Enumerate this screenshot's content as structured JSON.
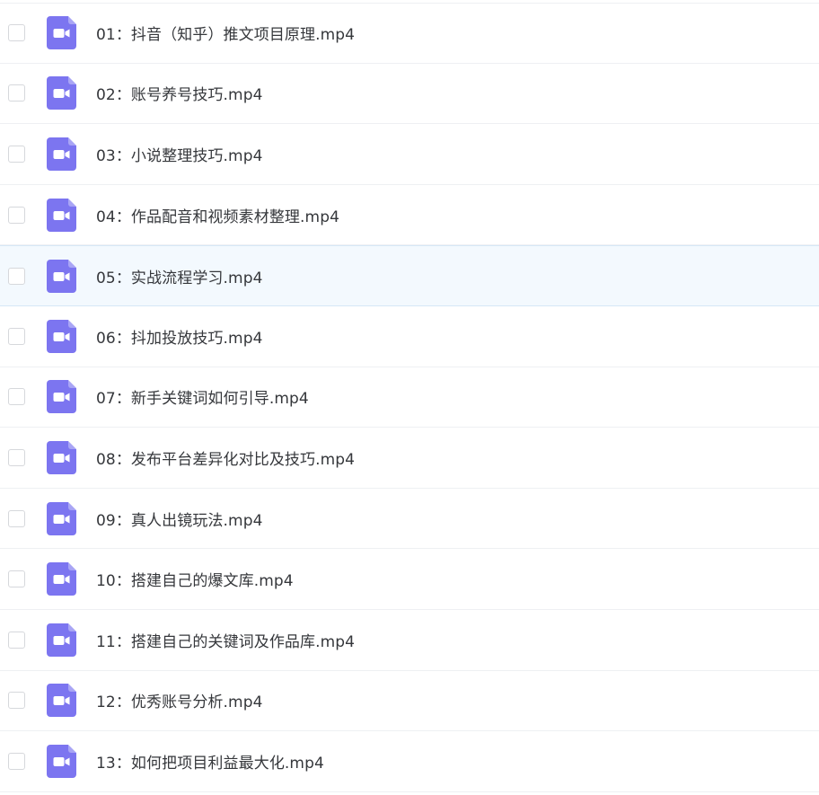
{
  "file_list": {
    "icon": "video-file-icon",
    "icon_color": "#7c75f0",
    "hovered_index": 4,
    "hover_color": "#f3f9fe",
    "items": [
      {
        "name": "01：抖音（知乎）推文项目原理.mp4"
      },
      {
        "name": "02：账号养号技巧.mp4"
      },
      {
        "name": "03：小说整理技巧.mp4"
      },
      {
        "name": "04：作品配音和视频素材整理.mp4"
      },
      {
        "name": "05：实战流程学习.mp4"
      },
      {
        "name": "06：抖加投放技巧.mp4"
      },
      {
        "name": "07：新手关键词如何引导.mp4"
      },
      {
        "name": "08：发布平台差异化对比及技巧.mp4"
      },
      {
        "name": "09：真人出镜玩法.mp4"
      },
      {
        "name": "10：搭建自己的爆文库.mp4"
      },
      {
        "name": "11：搭建自己的关键词及作品库.mp4"
      },
      {
        "name": "12：优秀账号分析.mp4"
      },
      {
        "name": "13：如何把项目利益最大化.mp4"
      }
    ]
  }
}
